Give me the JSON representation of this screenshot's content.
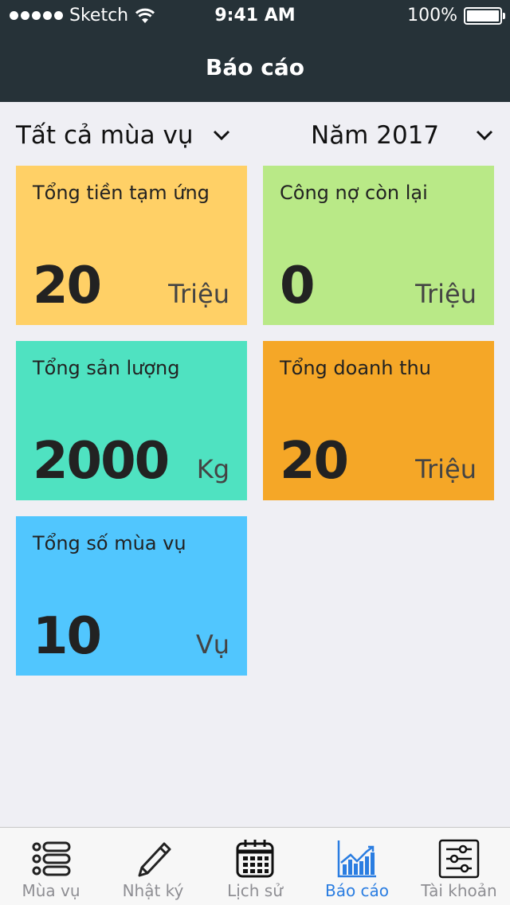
{
  "status_bar": {
    "carrier": "Sketch",
    "time": "9:41 AM",
    "battery": "100%"
  },
  "header": {
    "title": "Báo cáo"
  },
  "filters": {
    "season": "Tất cả mùa vụ",
    "year": "Năm 2017"
  },
  "cards": [
    {
      "label": "Tổng tiền tạm ứng",
      "value": "20",
      "unit": "Triệu",
      "color": "#ffd066"
    },
    {
      "label": "Công nợ còn lại",
      "value": "0",
      "unit": "Triệu",
      "color": "#b9e987"
    },
    {
      "label": "Tổng sản lượng",
      "value": "2000",
      "unit": "Kg",
      "color": "#4fe2c1"
    },
    {
      "label": "Tổng doanh thu",
      "value": "20",
      "unit": "Triệu",
      "color": "#f5a727"
    },
    {
      "label": "Tổng số mùa vụ",
      "value": "10",
      "unit": "Vụ",
      "color": "#51c6fe"
    }
  ],
  "tabs": [
    {
      "label": "Mùa vụ",
      "icon": "list-icon"
    },
    {
      "label": "Nhật ký",
      "icon": "pencil-icon"
    },
    {
      "label": "Lịch sử",
      "icon": "calendar-icon"
    },
    {
      "label": "Báo cáo",
      "icon": "chart-icon",
      "active": true
    },
    {
      "label": "Tài khoản",
      "icon": "settings-sliders-icon"
    }
  ],
  "colors": {
    "header_bg": "#263238",
    "background": "#efeff4",
    "active_tab": "#2a7de1",
    "inactive_tab": "#8e8e93"
  }
}
